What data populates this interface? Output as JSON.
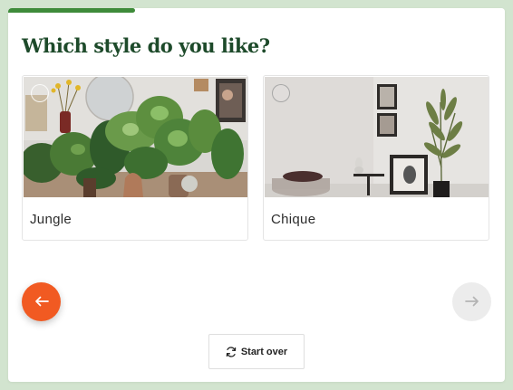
{
  "progress": {
    "value_percent": 25.5
  },
  "colors": {
    "page_background": "#d2e4cf",
    "progress_fill": "#3e8b3a",
    "title": "#1d4a2a",
    "prev_button": "#f15a22",
    "next_button": "#ececec"
  },
  "question": {
    "title": "Which style do you like?"
  },
  "options": [
    {
      "label": "Jungle",
      "image": "plants-wall-photo",
      "selected": false
    },
    {
      "label": "Chique",
      "image": "minimal-interior-photo",
      "selected": false
    }
  ],
  "navigation": {
    "prev_icon": "arrow-left-icon",
    "next_icon": "arrow-right-icon"
  },
  "start_over": {
    "label": "Start over",
    "icon": "refresh-icon"
  }
}
